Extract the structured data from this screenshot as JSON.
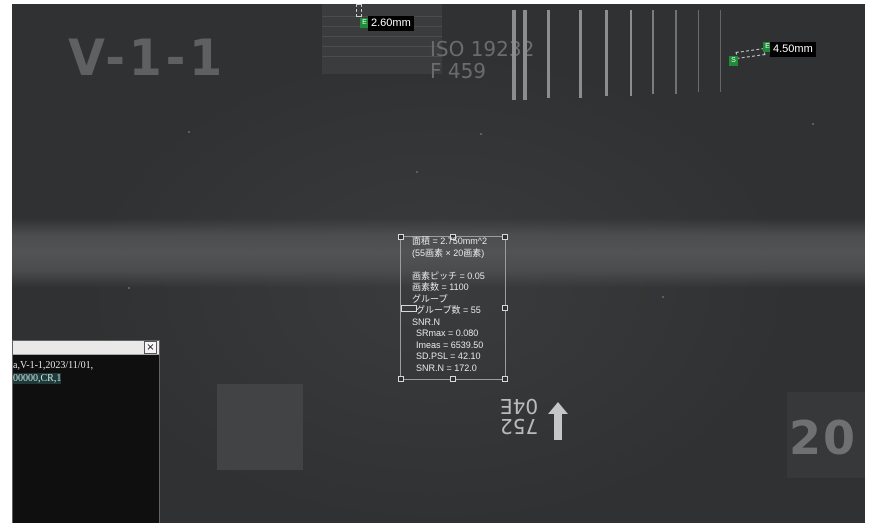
{
  "image": {
    "plate_label_left": "V-1-1",
    "iqi_text_line1": "ISO 19232",
    "iqi_text_line2": "F 459",
    "plate_label_right": "20",
    "lead_marker_line1": "04E",
    "lead_marker_line2": "752"
  },
  "measurements": {
    "ruler1": {
      "end_marker": "E",
      "value": "2.60mm"
    },
    "ruler2": {
      "start_marker": "S",
      "end_marker": "E",
      "value": "4.50mm"
    }
  },
  "roi_stats": {
    "lines": [
      "面積 = 2.750mm^2",
      "(55画素 × 20画素)",
      "",
      "画素ピッチ = 0.05",
      "画素数 = 1100",
      "グループ",
      "グループ数 = 55",
      "SNR.N",
      "SRmax = 0.080",
      "Imeas = 6539.50",
      "SD.PSL = 42.10",
      "SNR.N = 172.0"
    ]
  },
  "text_panel": {
    "close_label": "×",
    "line1": "a,V-1-1,2023/11/01,",
    "line2": "00000,CR,1"
  },
  "colors": {
    "background": "#2f3132",
    "marker_green": "#1e8a3a",
    "label_bg": "#000000"
  }
}
